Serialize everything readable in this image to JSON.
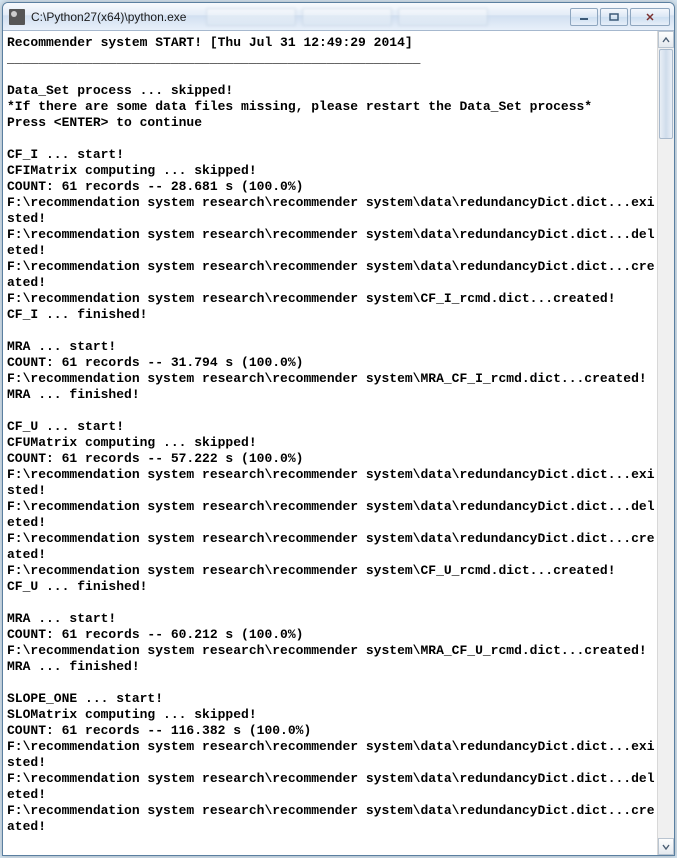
{
  "window": {
    "title": "C:\\Python27(x64)\\python.exe"
  },
  "console": {
    "lines": [
      "Recommender system START! [Thu Jul 31 12:49:29 2014]",
      "_____________________________________________________",
      "",
      "Data_Set process ... skipped!",
      "*If there are some data files missing, please restart the Data_Set process*",
      "Press <ENTER> to continue",
      "",
      "CF_I ... start!",
      "CFIMatrix computing ... skipped!",
      "COUNT: 61 records -- 28.681 s (100.0%)",
      "F:\\recommendation system research\\recommender system\\data\\redundancyDict.dict...existed!",
      "F:\\recommendation system research\\recommender system\\data\\redundancyDict.dict...deleted!",
      "F:\\recommendation system research\\recommender system\\data\\redundancyDict.dict...created!",
      "F:\\recommendation system research\\recommender system\\CF_I_rcmd.dict...created!",
      "CF_I ... finished!",
      "",
      "MRA ... start!",
      "COUNT: 61 records -- 31.794 s (100.0%)",
      "F:\\recommendation system research\\recommender system\\MRA_CF_I_rcmd.dict...created!",
      "MRA ... finished!",
      "",
      "CF_U ... start!",
      "CFUMatrix computing ... skipped!",
      "COUNT: 61 records -- 57.222 s (100.0%)",
      "F:\\recommendation system research\\recommender system\\data\\redundancyDict.dict...existed!",
      "F:\\recommendation system research\\recommender system\\data\\redundancyDict.dict...deleted!",
      "F:\\recommendation system research\\recommender system\\data\\redundancyDict.dict...created!",
      "F:\\recommendation system research\\recommender system\\CF_U_rcmd.dict...created!",
      "CF_U ... finished!",
      "",
      "MRA ... start!",
      "COUNT: 61 records -- 60.212 s (100.0%)",
      "F:\\recommendation system research\\recommender system\\MRA_CF_U_rcmd.dict...created!",
      "MRA ... finished!",
      "",
      "SLOPE_ONE ... start!",
      "SLOMatrix computing ... skipped!",
      "COUNT: 61 records -- 116.382 s (100.0%)",
      "F:\\recommendation system research\\recommender system\\data\\redundancyDict.dict...existed!",
      "F:\\recommendation system research\\recommender system\\data\\redundancyDict.dict...deleted!",
      "F:\\recommendation system research\\recommender system\\data\\redundancyDict.dict...created!"
    ]
  },
  "buttons": {
    "minimize": "minimize",
    "maximize": "maximize",
    "close": "close"
  }
}
